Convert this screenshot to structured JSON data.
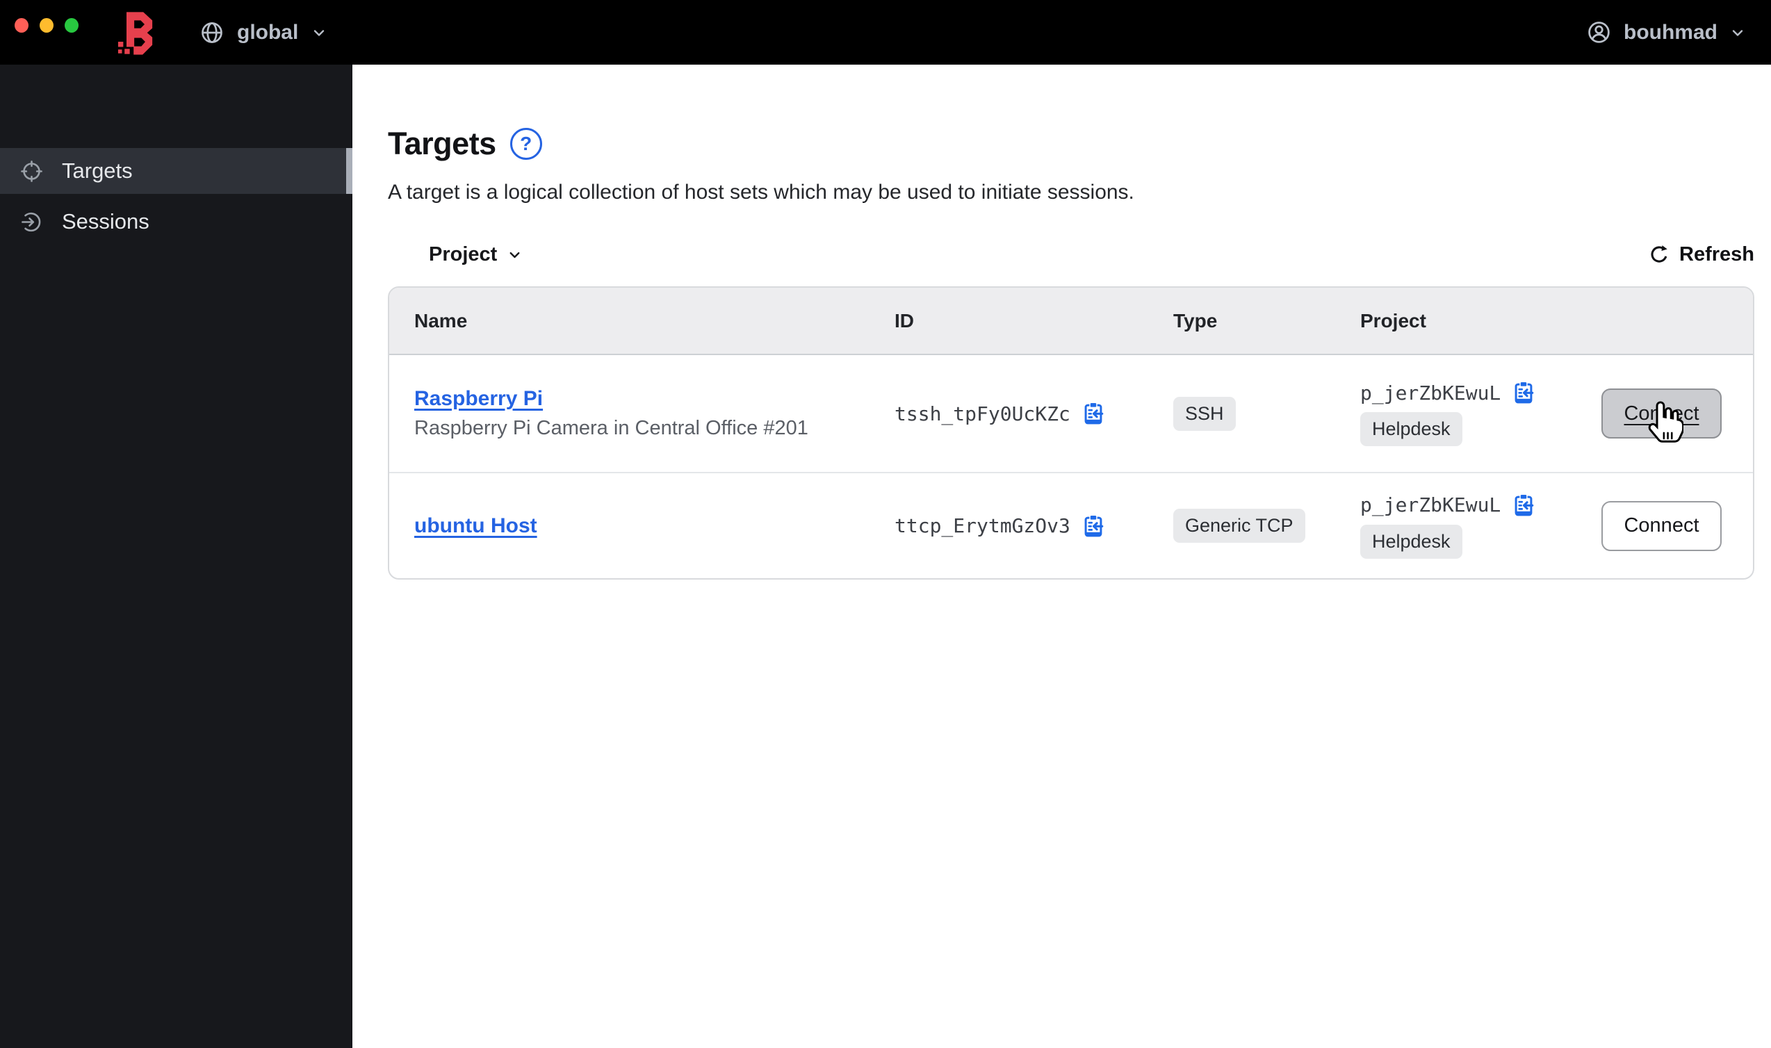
{
  "topbar": {
    "scope_label": "global",
    "user_label": "bouhmad"
  },
  "sidebar": {
    "items": [
      {
        "label": "Targets",
        "icon": "target-icon",
        "active": true
      },
      {
        "label": "Sessions",
        "icon": "login-icon",
        "active": false
      }
    ]
  },
  "main": {
    "title": "Targets",
    "help_glyph": "?",
    "description": "A target is a logical collection of host sets which may be used to initiate sessions.",
    "filter_label": "Project",
    "refresh_label": "Refresh",
    "table": {
      "columns": [
        "Name",
        "ID",
        "Type",
        "Project"
      ],
      "rows": [
        {
          "name": "Raspberry Pi",
          "description": "Raspberry Pi Camera in Central Office #201",
          "id": "tssh_tpFy0UcKZc",
          "type": "SSH",
          "project_id": "p_jerZbKEwuL",
          "project_name": "Helpdesk",
          "connect_label": "Connect",
          "state": "hovered"
        },
        {
          "name": "ubuntu Host",
          "description": "",
          "id": "ttcp_ErytmGzOv3",
          "type": "Generic TCP",
          "project_id": "p_jerZbKEwuL",
          "project_name": "Helpdesk",
          "connect_label": "Connect",
          "state": "default"
        }
      ]
    }
  },
  "colors": {
    "brand_red": "#e6404d",
    "link_blue": "#2563e2",
    "copy_icon_blue": "#1f6ae8",
    "topbar_bg": "#000000",
    "sidebar_bg": "#17181c",
    "sidebar_active_bg": "#2e3138",
    "table_header_bg": "#ededef",
    "badge_bg": "#e8e9eb"
  }
}
